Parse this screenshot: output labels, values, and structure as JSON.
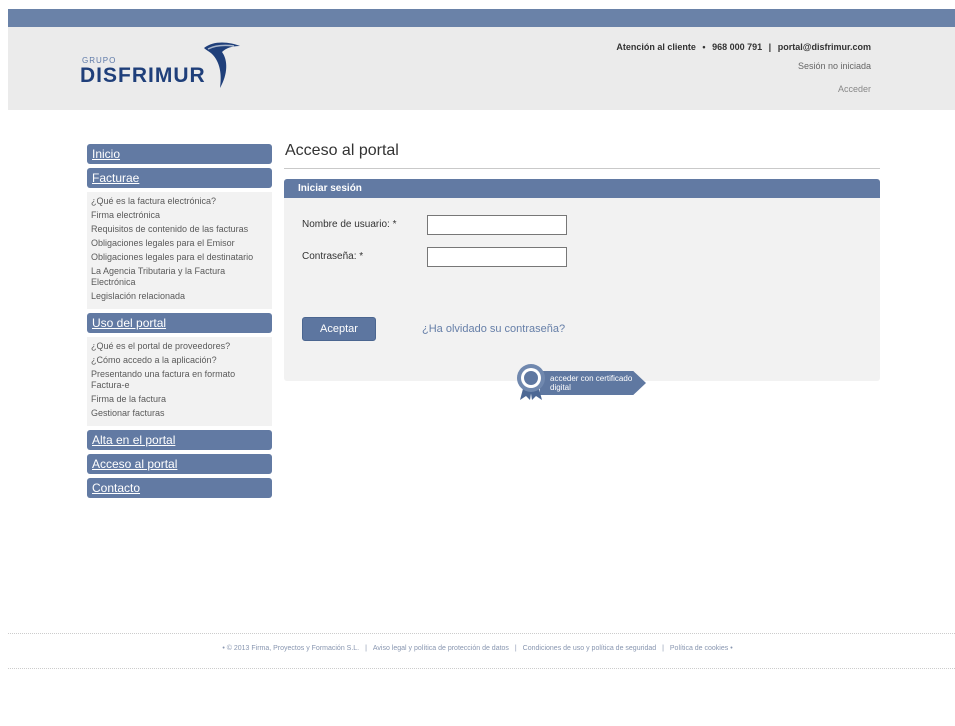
{
  "header": {
    "logo_small": "GRUPO",
    "logo_name": "DISFRIMUR",
    "contact_label": "Atención al cliente",
    "bullet": "•",
    "phone": "968 000 791",
    "separator": "|",
    "email": "portal@disfrimur.com",
    "session_status": "Sesión no iniciada",
    "login_link": "Acceder"
  },
  "sidebar": {
    "inicio": "Inicio",
    "facturae": {
      "title": "Facturae",
      "items": [
        "¿Qué es la factura electrónica?",
        "Firma electrónica",
        "Requisitos de contenido de las facturas",
        "Obligaciones legales para el Emisor",
        "Obligaciones legales para el destinatario",
        "La Agencia Tributaria y la Factura Electrónica",
        "Legislación relacionada"
      ]
    },
    "uso": {
      "title": "Uso del portal",
      "items": [
        "¿Qué es el portal de proveedores?",
        "¿Cómo accedo a la aplicación?",
        "Presentando una factura en formato Factura-e",
        "Firma de la factura",
        "Gestionar facturas"
      ]
    },
    "alta": "Alta en el portal",
    "acceso": "Acceso al portal",
    "contacto": "Contacto"
  },
  "main": {
    "page_title": "Acceso al portal",
    "login_title": "Iniciar sesión",
    "username_label": "Nombre de usuario: *",
    "password_label": "Contraseña: *",
    "username_value": "",
    "password_value": "",
    "accept_label": "Aceptar",
    "forgot_link": "¿Ha olvidado su contraseña?",
    "cert_label": "acceder con certificado digital"
  },
  "footer": {
    "copyright": "• © 2013 Firma, Proyectos y Formación S.L.",
    "legal": "Aviso legal y política de protección de datos",
    "conditions": "Condiciones de uso y política de seguridad",
    "cookies": "Política de cookies •",
    "separator": "|"
  },
  "colors": {
    "nav_blue": "#627aa3",
    "top_bar": "#6a82a8",
    "logo_blue": "#1f3f7a",
    "link_blue": "#667fa8"
  },
  "icons": [
    "bird-logo-icon",
    "certificate-seal-icon"
  ]
}
